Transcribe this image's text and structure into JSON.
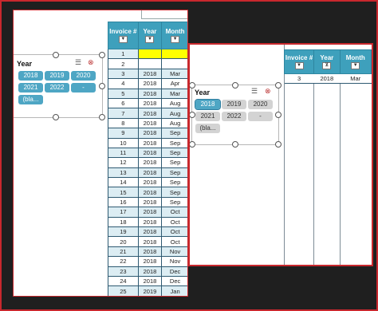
{
  "back_sheet": {
    "slicer": {
      "title": "Year",
      "options": [
        "2018",
        "2019",
        "2020",
        "2021",
        "2022",
        "-",
        "(bla..."
      ]
    },
    "table": {
      "headers": [
        "Invoice #",
        "Year",
        "Month"
      ],
      "rows": [
        {
          "n": "1",
          "year": "",
          "month": ""
        },
        {
          "n": "2",
          "year": "",
          "month": ""
        },
        {
          "n": "3",
          "year": "2018",
          "month": "Mar"
        },
        {
          "n": "4",
          "year": "2018",
          "month": "Apr"
        },
        {
          "n": "5",
          "year": "2018",
          "month": "Mar"
        },
        {
          "n": "6",
          "year": "2018",
          "month": "Aug"
        },
        {
          "n": "7",
          "year": "2018",
          "month": "Aug"
        },
        {
          "n": "8",
          "year": "2018",
          "month": "Aug"
        },
        {
          "n": "9",
          "year": "2018",
          "month": "Sep"
        },
        {
          "n": "10",
          "year": "2018",
          "month": "Sep"
        },
        {
          "n": "11",
          "year": "2018",
          "month": "Sep"
        },
        {
          "n": "12",
          "year": "2018",
          "month": "Sep"
        },
        {
          "n": "13",
          "year": "2018",
          "month": "Sep"
        },
        {
          "n": "14",
          "year": "2018",
          "month": "Sep"
        },
        {
          "n": "15",
          "year": "2018",
          "month": "Sep"
        },
        {
          "n": "16",
          "year": "2018",
          "month": "Sep"
        },
        {
          "n": "17",
          "year": "2018",
          "month": "Oct"
        },
        {
          "n": "18",
          "year": "2018",
          "month": "Oct"
        },
        {
          "n": "19",
          "year": "2018",
          "month": "Oct"
        },
        {
          "n": "20",
          "year": "2018",
          "month": "Oct"
        },
        {
          "n": "21",
          "year": "2018",
          "month": "Nov"
        },
        {
          "n": "22",
          "year": "2018",
          "month": "Nov"
        },
        {
          "n": "23",
          "year": "2018",
          "month": "Dec"
        },
        {
          "n": "24",
          "year": "2018",
          "month": "Dec"
        },
        {
          "n": "25",
          "year": "2019",
          "month": "Jan"
        }
      ]
    }
  },
  "front_sheet": {
    "slicer": {
      "title": "Year",
      "options": [
        "2018",
        "2019",
        "2020",
        "2021",
        "2022",
        "-",
        "(bla..."
      ]
    },
    "table": {
      "headers": [
        "Invoice #",
        "Year",
        "Month"
      ],
      "row": {
        "n": "3",
        "year": "2018",
        "month": "Mar"
      }
    }
  },
  "icons": {
    "multiselect": "multi-select-icon",
    "clear_filter": "clear-filter-icon",
    "dropdown": "dropdown-arrow-icon",
    "filtered": "filter-applied-icon"
  }
}
